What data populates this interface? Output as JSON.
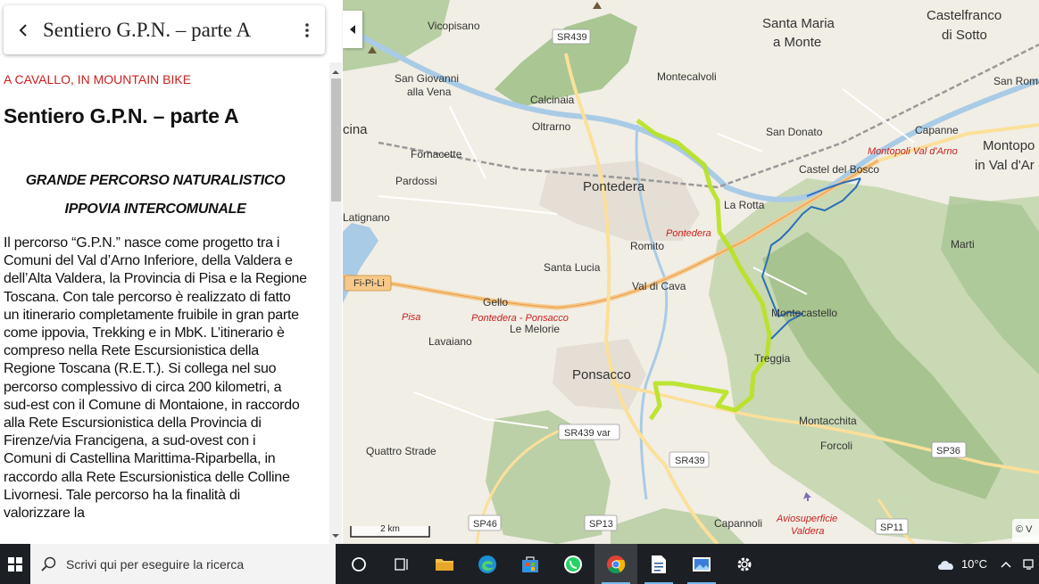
{
  "header": {
    "title": "Sentiero G.P.N. – parte A"
  },
  "article": {
    "category": "A CAVALLO, IN MOUNTAIN BIKE",
    "title": "Sentiero G.P.N. – parte A",
    "subtitle1": "GRANDE PERCORSO NATURALISTICO",
    "subtitle2": "IPPOVIA INTERCOMUNALE",
    "body": "Il percorso “G.P.N.” nasce come progetto tra i Comuni del Val d’Arno Inferiore, della Valdera e dell’Alta Valdera, la Provincia di Pisa e la Regione Toscana. Con tale percorso è realizzato di fatto un itinerario completamente fruibile in gran parte come ippovia, Trekking e in MbK. L’itinerario è compreso nella Rete Escursionistica della Regione Toscana (R.E.T.). Si collega nel suo percorso complessivo di circa 200 kilometri, a sud-est con il Comune di Montaione, in raccordo alla Rete Escursionistica della Provincia di Firenze/via Francigena, a sud-ovest con i Comuni di Castellina Marittima-Riparbella, in raccordo alla Rete Escursionistica delle Colline Livornesi. Tale percorso ha la finalità di valorizzare la"
  },
  "map": {
    "labels": {
      "vicopisano": "Vicopisano",
      "sr439_top": "SR439",
      "santa_maria": "Santa Maria",
      "a_monte": "a Monte",
      "castelfranco": "Castelfranco",
      "di_sotto": "di Sotto",
      "san_giovanni": "San Giovanni",
      "alla_vena": "alla Vena",
      "montecalvoli": "Montecalvoli",
      "san_roman": "San Romar",
      "calcinaia": "Calcinaia",
      "cina": "cina",
      "oltrarno": "Oltrarno",
      "san_donato": "San Donato",
      "capanne": "Capanne",
      "montopoli_red": "Montopoli Val d'Arno",
      "montopoli1": "Montopo",
      "montopoli2": "in Val d'Ar",
      "fornacette": "Fornacette",
      "castel_del_bosco": "Castel del Bosco",
      "pardossi": "Pardossi",
      "pontedera": "Pontedera",
      "la_rotta": "La Rotta",
      "latignano": "Latignano",
      "pontedera_red": "Pontedera",
      "romito": "Romito",
      "marti": "Marti",
      "santa_lucia": "Santa Lucia",
      "fi_pi_li": "Fi-Pi-Li",
      "val_di_cava": "Val di Cava",
      "gello": "Gello",
      "pisa_red": "Pisa",
      "pontedera_ponsacco": "Pontedera - Ponsacco",
      "montecastello": "Montecastello",
      "le_melorie": "Le Melorie",
      "lavaiano": "Lavaiano",
      "treggia": "Treggia",
      "ponsacco": "Ponsacco",
      "montacchita": "Montacchita",
      "sr439_var": "SR439 var",
      "forcoli": "Forcoli",
      "sp36": "SP36",
      "quattro_strade": "Quattro Strade",
      "sr439_mid": "SR439",
      "sp46": "SP46",
      "sp13": "SP13",
      "capannoli": "Capannoli",
      "aviosuperficie": "Aviosuperficie",
      "valdera": "Valdera",
      "sp11": "SP11"
    },
    "scale": "2 km",
    "attribution": "© V",
    "colors": {
      "route_green": "#b7e21f",
      "route_blue": "#2c6fb6",
      "water": "#a9cbe6",
      "forest": "#8ab27a"
    }
  },
  "taskbar": {
    "search_placeholder": "Scrivi qui per eseguire la ricerca",
    "temperature": "10°C"
  }
}
